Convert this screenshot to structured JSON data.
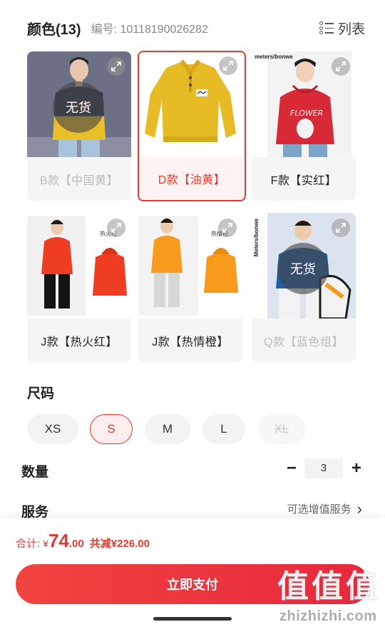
{
  "header": {
    "title": "颜色(13)",
    "code": "编号: 10118190026282",
    "list_label": "列表"
  },
  "swatches": [
    {
      "label": "B款【中国黄】",
      "status": "soldout",
      "soldout_text": "无货",
      "tint": "#e5be22"
    },
    {
      "label": "D款【油黄】",
      "status": "selected",
      "tint": "#e7bb26"
    },
    {
      "label": "F款【实红】",
      "status": "available",
      "tint": "#d82a36"
    },
    {
      "label": "J款【热火红】",
      "status": "available",
      "tint": "#ee3d22"
    },
    {
      "label": "J款【热情橙】",
      "status": "available",
      "tint": "#f89a1c"
    },
    {
      "label": "Q款【蓝色组】",
      "status": "soldout",
      "soldout_text": "无货",
      "tint": "#235fa8"
    }
  ],
  "swatch_brand_texts": {
    "f": "meters/bonwe",
    "j1_tag": "热火红",
    "j2_tag": "热情橙",
    "q": "Meters/bonwe"
  },
  "size": {
    "title": "尺码",
    "options": [
      {
        "label": "XS",
        "state": "normal"
      },
      {
        "label": "S",
        "state": "selected"
      },
      {
        "label": "M",
        "state": "normal"
      },
      {
        "label": "L",
        "state": "normal"
      },
      {
        "label": "XL",
        "state": "disabled"
      }
    ]
  },
  "quantity": {
    "title": "数量",
    "value": "3",
    "minus": "−",
    "plus": "+"
  },
  "service": {
    "title": "服务",
    "link_text": "可选增值服务",
    "chevron": "›"
  },
  "footer": {
    "total_label": "合计:",
    "currency": "¥",
    "amount_int": "74",
    "amount_dec": ".00",
    "discount": "共减¥226.00",
    "pay_label": "立即支付"
  },
  "watermark": {
    "glyphs": [
      "值",
      "值",
      "值"
    ],
    "text": "zhizhizhi.com"
  },
  "colors": {
    "accent": "#e33a2d",
    "soldout_text": "#bcbcbc"
  }
}
